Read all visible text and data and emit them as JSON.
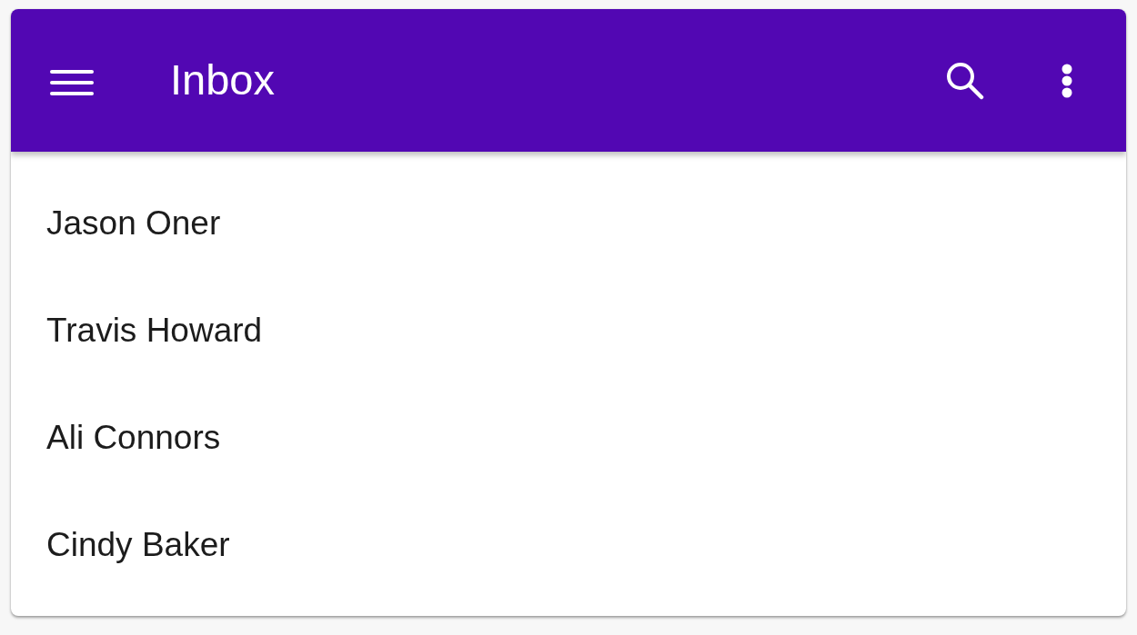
{
  "app_bar": {
    "title": "Inbox"
  },
  "list": {
    "items": [
      {
        "name": "Jason Oner"
      },
      {
        "name": "Travis Howard"
      },
      {
        "name": "Ali Connors"
      },
      {
        "name": "Cindy Baker"
      }
    ]
  }
}
